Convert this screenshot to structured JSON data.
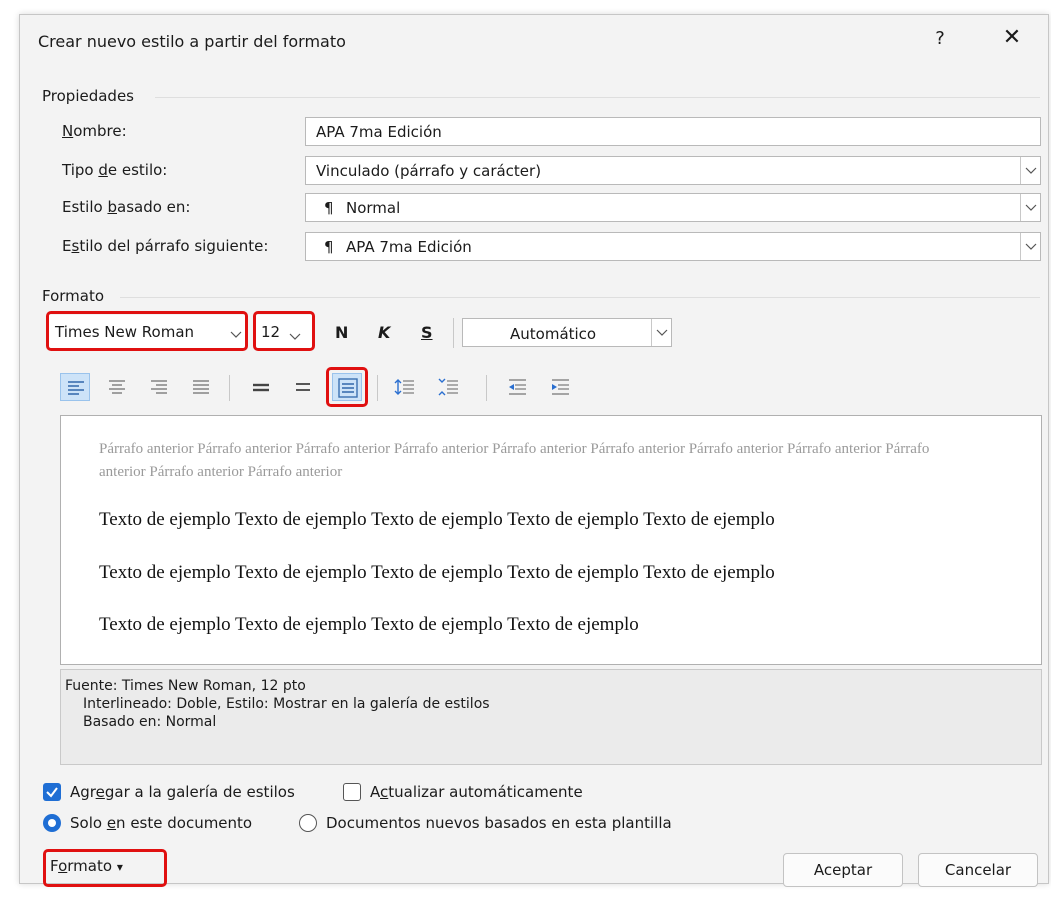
{
  "dialog": {
    "title": "Crear nuevo estilo a partir del formato",
    "help": "?",
    "close": "✕"
  },
  "properties": {
    "section_label": "Propiedades",
    "name": {
      "label_pre": "",
      "label_u": "N",
      "label_post": "ombre:",
      "value": "APA 7ma Edición"
    },
    "style_type": {
      "label_pre": "Tipo ",
      "label_u": "d",
      "label_post": "e estilo:",
      "value": "Vinculado (párrafo y carácter)"
    },
    "based_on": {
      "label_pre": "Estilo ",
      "label_u": "b",
      "label_post": "asado en:",
      "symbol": "¶",
      "value": "Normal"
    },
    "next_style": {
      "label_pre": "E",
      "label_u": "s",
      "label_post": "tilo del párrafo siguiente:",
      "symbol": "¶",
      "value": "APA 7ma Edición"
    }
  },
  "formatting": {
    "section_label": "Formato",
    "font": "Times New Roman",
    "size": "12",
    "bold": "N",
    "italic": "K",
    "underline": "S",
    "color": "Automático",
    "selected_spacing": "double"
  },
  "preview": {
    "previous_paragraph": "Párrafo anterior Párrafo anterior Párrafo anterior Párrafo anterior Párrafo anterior Párrafo anterior Párrafo anterior Párrafo anterior Párrafo anterior Párrafo anterior Párrafo anterior",
    "lines": [
      "Texto de ejemplo Texto de ejemplo Texto de ejemplo Texto de ejemplo Texto de ejemplo",
      "Texto de ejemplo Texto de ejemplo Texto de ejemplo Texto de ejemplo Texto de ejemplo",
      "Texto de ejemplo Texto de ejemplo Texto de ejemplo Texto de ejemplo"
    ]
  },
  "description": {
    "line1": "Fuente: Times New Roman, 12 pto",
    "line2": "Interlineado:  Doble, Estilo: Mostrar en la galería de estilos",
    "line3": "Basado en: Normal"
  },
  "options": {
    "add_gallery": {
      "pre": "Agr",
      "u": "e",
      "post": "gar a la galería de estilos",
      "checked": true
    },
    "auto_update": {
      "pre": "A",
      "u": "c",
      "post": "tualizar automáticamente",
      "checked": false
    },
    "only_doc": {
      "pre": "Solo ",
      "u": "e",
      "post": "n este documento",
      "selected": true
    },
    "new_docs": {
      "label": "Documentos nuevos basados en esta plantilla",
      "selected": false
    }
  },
  "buttons": {
    "format_pre": "F",
    "format_u": "o",
    "format_post": "rmato",
    "format_caret": "▾",
    "ok": "Aceptar",
    "cancel": "Cancelar"
  },
  "colors": {
    "accent": "#1f6ed4",
    "highlight": "#e01010",
    "selected_bg": "#cde3f8"
  }
}
